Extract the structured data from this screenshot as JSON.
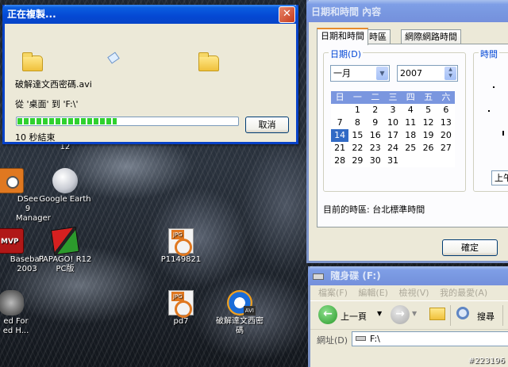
{
  "copy_dialog": {
    "title": "正在複製...",
    "filename": "破解達文西密碼.avi",
    "from_to": "從 '桌面' 到 'F:\\'",
    "time_left": "10 秒結束",
    "cancel_label": "取消",
    "progress_percent": 45
  },
  "datetime_window": {
    "title": "日期和時間 內容",
    "tabs": [
      {
        "label": "日期和時間",
        "active": true
      },
      {
        "label": "時區",
        "active": false
      },
      {
        "label": "網際網路時間",
        "active": false
      }
    ],
    "date_group_label": "日期(D)",
    "time_group_label": "時間",
    "month": "一月",
    "year": "2007",
    "weekdays": [
      "日",
      "一",
      "二",
      "三",
      "四",
      "五",
      "六"
    ],
    "days": [
      "",
      "1",
      "2",
      "3",
      "4",
      "5",
      "6",
      "7",
      "8",
      "9",
      "10",
      "11",
      "12",
      "13",
      "14",
      "15",
      "16",
      "17",
      "18",
      "19",
      "20",
      "21",
      "22",
      "23",
      "24",
      "25",
      "26",
      "27",
      "28",
      "29",
      "30",
      "31",
      "",
      "",
      ""
    ],
    "selected_day": "14",
    "timezone_text": "目前的時區: 台北標準時間",
    "ok_label": "確定",
    "ampm_partial": "上午"
  },
  "removable_window": {
    "title": "隨身碟 (F:)",
    "menu": [
      "檔案(F)",
      "編輯(E)",
      "檢視(V)",
      "我的最愛(A)"
    ],
    "back_label": "上一頁",
    "search_label": "搜尋",
    "address_label": "網址(D)",
    "address_value": "F:\\"
  },
  "desktop": {
    "icons": [
      {
        "label": "12"
      },
      {
        "label": "DSee 9 Manager"
      },
      {
        "label": "Google Earth"
      },
      {
        "label": "Baseball 2003"
      },
      {
        "label": "PAPAGO! R12 PC版"
      },
      {
        "label": "P1149821"
      },
      {
        "label": "ed For ed H..."
      },
      {
        "label": "pd7"
      },
      {
        "label": "破解達文西密碼"
      }
    ],
    "watermark": "#223196"
  }
}
